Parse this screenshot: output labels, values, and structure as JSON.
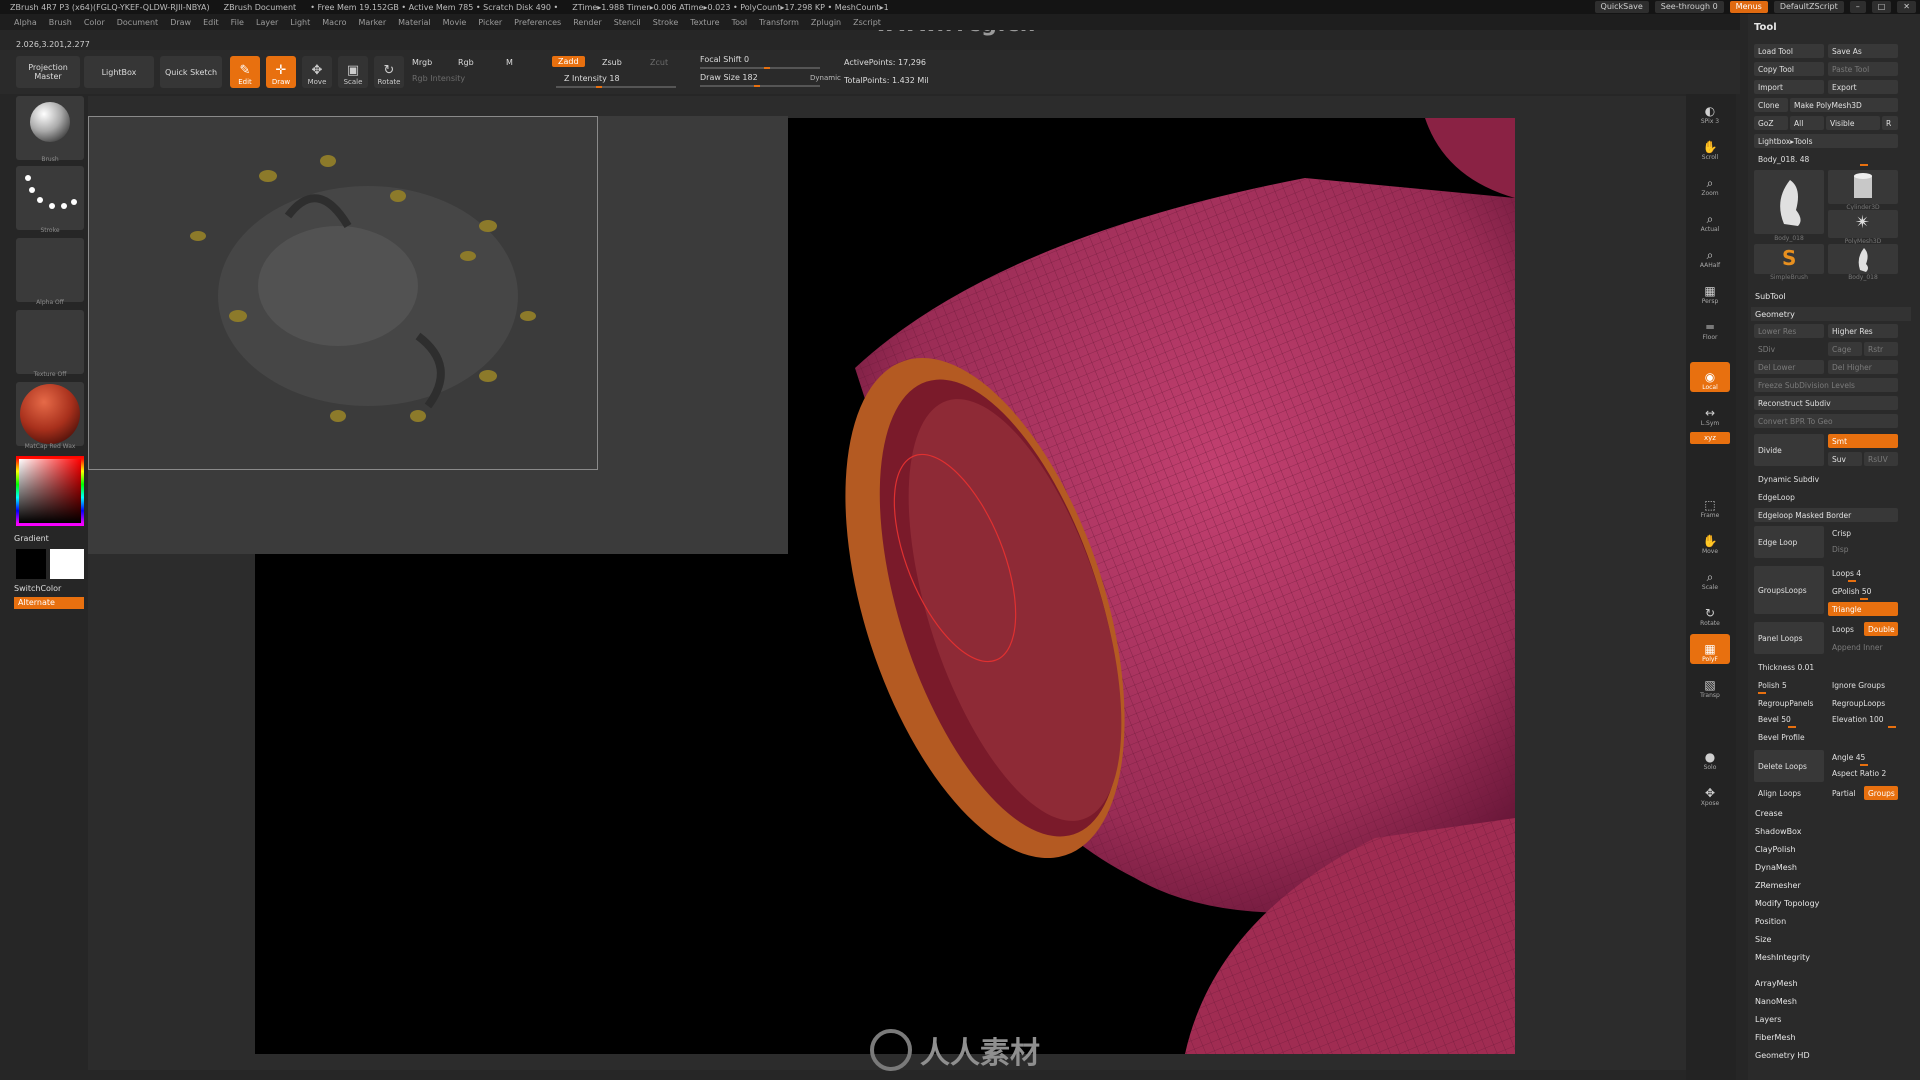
{
  "titlebar": {
    "items": [
      "ZBrush 4R7 P3 (x64)(FGLQ-YKEF-QLDW-RJII-NBYA)",
      "ZBrush Document",
      "• Free Mem 19.152GB • Active Mem 785 • Scratch Disk 490 •",
      "ZTime▸1.988 Timer▸0.006 ATime▸0.023 • PolyCount▸17.298 KP • MeshCount▸1"
    ],
    "quicksave": "QuickSave",
    "see_through": "See-through  0",
    "menus_btn": "Menus",
    "default_script": "DefaultZScript"
  },
  "watermark_url": "www.rrcg.cn",
  "menubar": [
    "Alpha",
    "Brush",
    "Color",
    "Document",
    "Draw",
    "Edit",
    "File",
    "Layer",
    "Light",
    "Macro",
    "Marker",
    "Material",
    "Movie",
    "Picker",
    "Preferences",
    "Render",
    "Stencil",
    "Stroke",
    "Texture",
    "Tool",
    "Transform",
    "Zplugin",
    "Zscript"
  ],
  "coords": "2.026,3.201,2.277",
  "shelf": {
    "projection_master": "Projection Master",
    "lightbox": "LightBox",
    "quick_sketch": "Quick Sketch",
    "tools": [
      {
        "label": "Edit",
        "glyph": "✎",
        "active": true
      },
      {
        "label": "Draw",
        "glyph": "✛",
        "active": true
      },
      {
        "label": "Move",
        "glyph": "✥",
        "active": false
      },
      {
        "label": "Scale",
        "glyph": "▣",
        "active": false
      },
      {
        "label": "Rotate",
        "glyph": "↻",
        "active": false
      }
    ],
    "mrgb": "Mrgb",
    "rgb": "Rgb",
    "m": "M",
    "rgb_intensity": "Rgb Intensity",
    "zadd": "Zadd",
    "zsub": "Zsub",
    "zcut": "Zcut",
    "z_intensity": "Z Intensity 18",
    "focal_shift": "Focal Shift 0",
    "draw_size": "Draw Size 182",
    "dynamic": "Dynamic",
    "active_points": "ActivePoints: 17,296",
    "total_points": "TotalPoints: 1.432 Mil"
  },
  "leftshelf": {
    "thumbs": [
      "Brush",
      "Stroke",
      "Alpha Off",
      "Texture Off",
      "MatCap Red Wax"
    ],
    "gradient": "Gradient",
    "switch_color": "SwitchColor",
    "alternate": "Alternate"
  },
  "navcol": [
    {
      "label": "SPix 3",
      "glyph": "◐",
      "orange": false
    },
    {
      "label": "Scroll",
      "glyph": "✋",
      "orange": false
    },
    {
      "label": "Zoom",
      "glyph": "⌕",
      "orange": false
    },
    {
      "label": "Actual",
      "glyph": "⌕",
      "orange": false
    },
    {
      "label": "AAHalf",
      "glyph": "⌕",
      "orange": false
    },
    {
      "label": "Persp",
      "glyph": "▦",
      "orange": false
    },
    {
      "label": "Floor",
      "glyph": "═",
      "orange": false
    },
    {
      "label": "Local",
      "glyph": "◉",
      "orange": true
    },
    {
      "label": "L.Sym",
      "glyph": "↔",
      "orange": false
    },
    {
      "label": "Frame",
      "glyph": "⬚",
      "orange": false
    },
    {
      "label": "Move",
      "glyph": "✋",
      "orange": false
    },
    {
      "label": "Scale",
      "glyph": "⌕",
      "orange": false
    },
    {
      "label": "Rotate",
      "glyph": "↻",
      "orange": false
    },
    {
      "label": "PolyF",
      "glyph": "▦",
      "orange": true
    },
    {
      "label": "Transp",
      "glyph": "▧",
      "orange": false
    },
    {
      "label": "Solo",
      "glyph": "●",
      "orange": false
    },
    {
      "label": "Xpose",
      "glyph": "✥",
      "orange": false
    }
  ],
  "toolpanel": {
    "title": "Tool",
    "load_tool": "Load Tool",
    "save_as": "Save As",
    "copy_tool": "Copy Tool",
    "paste_tool": "Paste Tool",
    "import": "Import",
    "export": "Export",
    "clone": "Clone",
    "make_polymesh": "Make PolyMesh3D",
    "goz": "GoZ",
    "all": "All",
    "visible": "Visible",
    "r": "R",
    "lightbox_tools": "Lightbox▸Tools",
    "current_tool": "Body_018. 48",
    "thumbs": [
      "Body_018",
      "Cylinder3D",
      "PolyMesh3D",
      "SimpleBrush",
      "Body_018"
    ],
    "subtool": "SubTool",
    "geometry": "Geometry",
    "lower_res": "Lower Res",
    "higher_res": "Higher Res",
    "sdiv": "SDiv",
    "cage": "Cage",
    "rstr": "Rstr",
    "del_lower": "Del Lower",
    "del_higher": "Del Higher",
    "freeze_subdiv": "Freeze SubDivision Levels",
    "reconstruct_subdiv": "Reconstruct Subdiv",
    "convert_bpr": "Convert BPR To Geo",
    "divide": "Divide",
    "smt": "Smt",
    "suv": "Suv",
    "ruv": "RsUV",
    "dynamic_subdiv": "Dynamic Subdiv",
    "edgeloop": "EdgeLoop",
    "edgeloop_masked": "Edgeloop Masked Border",
    "edge_loop": "Edge Loop",
    "crisp": "Crisp",
    "disp": "Disp",
    "loops": "Loops 4",
    "groupsloops": "GroupsLoops",
    "gpolish": "GPolish 50",
    "triangle": "Triangle",
    "panel_loops": "Panel Loops",
    "loops2": "Loops",
    "double": "Double",
    "append_inner": "Append Inner",
    "thickness": "Thickness 0.01",
    "polish": "Polish 5",
    "ignore_groups": "Ignore Groups",
    "regroup_panels": "RegroupPanels",
    "regroup_loops": "RegroupLoops",
    "bevel": "Bevel 50",
    "elevation": "Elevation 100",
    "bevel_profile": "Bevel Profile",
    "angle": "Angle 45",
    "aspect_ratio": "Aspect Ratio 2",
    "delete_loops": "Delete Loops",
    "align_loops": "Align Loops",
    "partial": "Partial",
    "groups": "Groups",
    "sections": [
      "Crease",
      "ShadowBox",
      "ClayPolish",
      "DynaMesh",
      "ZRemesher",
      "Modify Topology",
      "Position",
      "Size",
      "MeshIntegrity"
    ],
    "subsections": [
      "ArrayMesh",
      "NanoMesh",
      "Layers",
      "FiberMesh",
      "Geometry HD"
    ]
  },
  "bottom_logo": "人人素材",
  "colors": {
    "accent": "#e8700f",
    "mesh": "#a8305a",
    "rim": "#c8702a",
    "panel": "#2a2a2a"
  }
}
